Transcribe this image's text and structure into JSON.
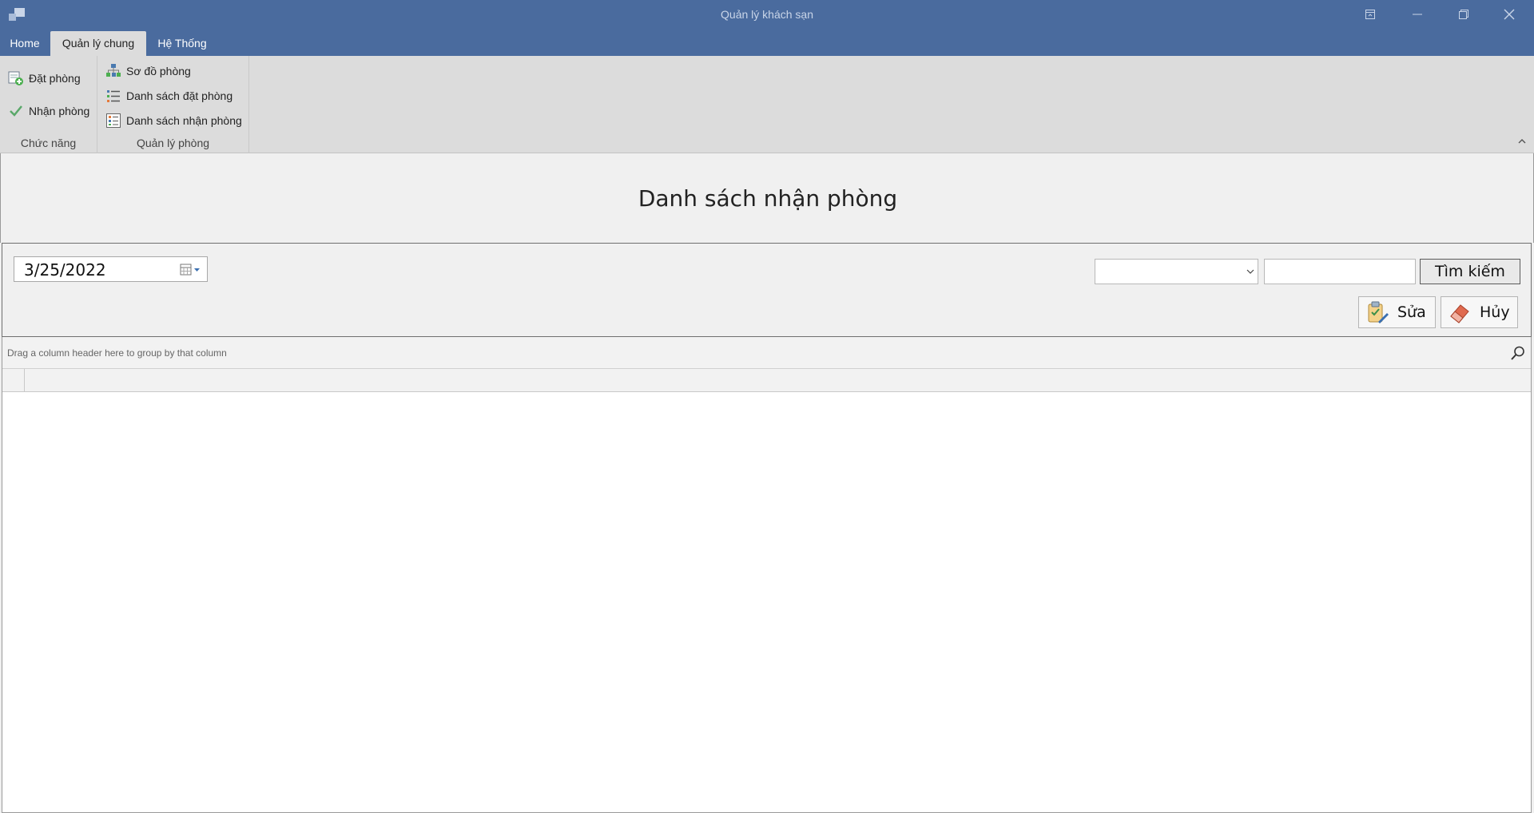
{
  "window": {
    "title": "Quản lý khách sạn"
  },
  "tabs": [
    {
      "label": "Home"
    },
    {
      "label": "Quản lý chung"
    },
    {
      "label": "Hệ Thống"
    }
  ],
  "ribbon": {
    "groups": [
      {
        "label": "Chức năng",
        "items": [
          {
            "label": "Đặt phòng",
            "icon": "add-booking-icon"
          },
          {
            "label": "Nhận phòng",
            "icon": "checkmark-icon"
          }
        ]
      },
      {
        "label": "Quản lý phòng",
        "items": [
          {
            "label": "Sơ đồ phòng",
            "icon": "room-map-icon"
          },
          {
            "label": "Danh sách đặt phòng",
            "icon": "list-icon"
          },
          {
            "label": "Danh sách nhận phòng",
            "icon": "checklist-icon"
          }
        ]
      }
    ]
  },
  "page": {
    "title": "Danh sách nhận phòng"
  },
  "filters": {
    "date_value": "3/25/2022",
    "combo_value": "",
    "search_value": "",
    "search_button": "Tìm kiếm"
  },
  "actions": {
    "edit_label": "Sửa",
    "cancel_label": "Hủy"
  },
  "grid": {
    "group_panel_hint": "Drag a column header here to group by that column"
  },
  "colors": {
    "titlebar": "#4a6b9e",
    "ribbon": "#dcdcdc",
    "background": "#f0f0f0"
  }
}
